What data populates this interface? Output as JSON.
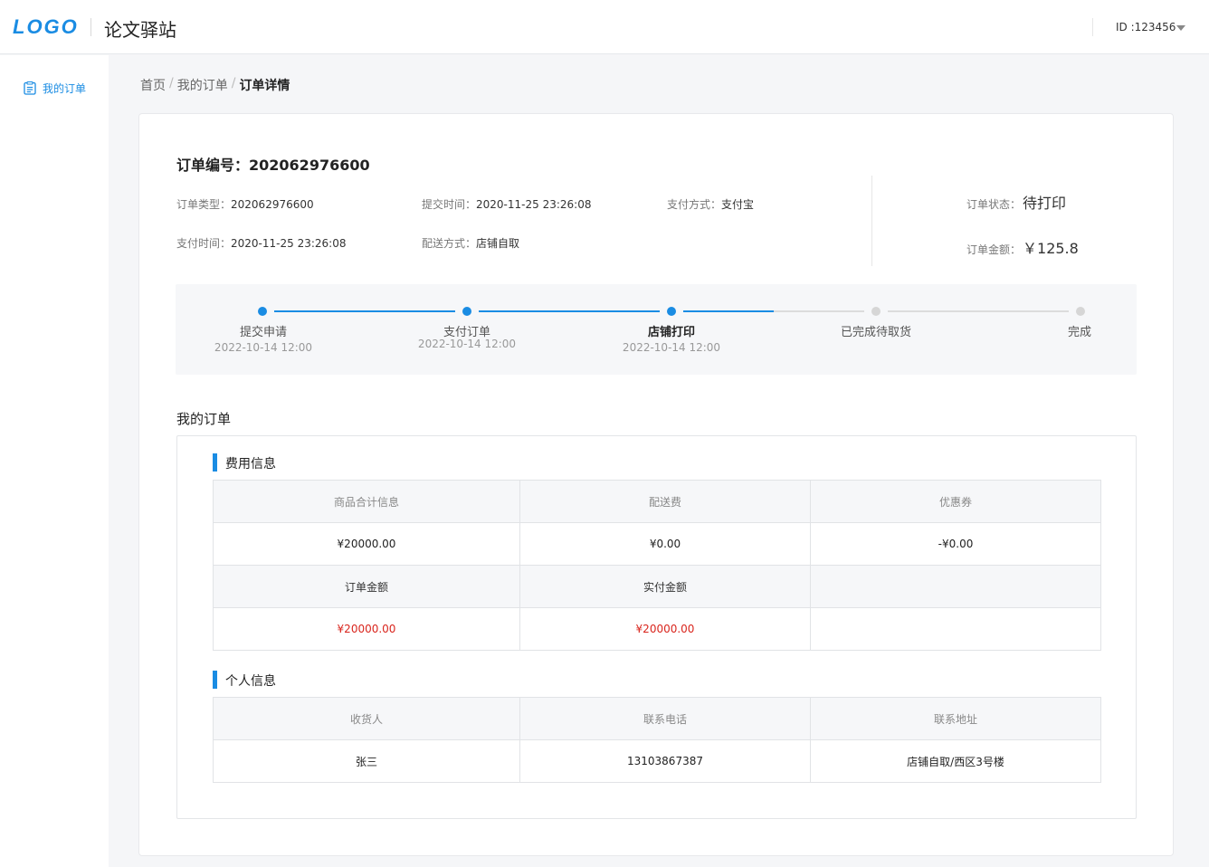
{
  "header": {
    "logo": "LOGO",
    "site_title": "论文驿站",
    "user_id": "ID :123456"
  },
  "sidebar": {
    "items": [
      {
        "label": "我的订单",
        "icon": "order-list-icon"
      }
    ]
  },
  "breadcrumb": [
    "首页",
    "我的订单",
    "订单详情"
  ],
  "order": {
    "number_label": "订单编号：",
    "number": "202062976600",
    "type_label": "订单类型：",
    "type": "202062976600",
    "submit_time_label": "提交时间：",
    "submit_time": "2020-11-25 23:26:08",
    "pay_method_label": "支付方式：",
    "pay_method": "支付宝",
    "pay_time_label": "支付时间：",
    "pay_time": "2020-11-25 23:26:08",
    "delivery_label": "配送方式：",
    "delivery": "店铺自取",
    "status_label": "订单状态：",
    "status": "待打印",
    "amount_label": "订单金额：",
    "amount": "￥125.8"
  },
  "steps": [
    {
      "label": "提交申请",
      "time": "2022-10-14 12:00",
      "done": true
    },
    {
      "label": "支付订单",
      "time": "2022-10-14 12:00",
      "done": true
    },
    {
      "label": "店铺打印",
      "time": "2022-10-14 12:00",
      "done": true,
      "active": true
    },
    {
      "label": "已完成待取货",
      "time": "",
      "done": false
    },
    {
      "label": "完成",
      "time": "",
      "done": false
    }
  ],
  "section_title": "我的订单",
  "fee": {
    "title": "费用信息",
    "headers": [
      "商品合计信息",
      "配送费",
      "优惠券"
    ],
    "values": [
      "¥20000.00",
      "¥0.00",
      "-¥0.00"
    ],
    "headers2": [
      "订单金额",
      "实付金额",
      ""
    ],
    "values2": [
      "¥20000.00",
      "¥20000.00",
      ""
    ]
  },
  "personal": {
    "title": "个人信息",
    "headers": [
      "收货人",
      "联系电话",
      "联系地址"
    ],
    "values": [
      "张三",
      "13103867387",
      "店铺自取/西区3号楼"
    ]
  },
  "colors": {
    "accent": "#1a8ce3",
    "price_red": "#d9251d"
  }
}
